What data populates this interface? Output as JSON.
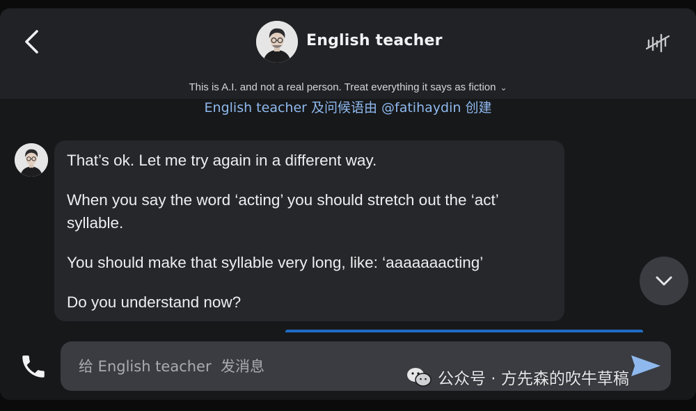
{
  "header": {
    "title": "English teacher",
    "disclaimer": "This is A.I. and not a real person. Treat everything it says as fiction",
    "back_icon": "chevron-left-icon",
    "voice_icon": "voice-waveform-icon"
  },
  "creator_line": "English teacher  及问候语由 @fatihaydin 创建",
  "message": {
    "paragraphs": [
      "That’s ok. Let me try again in a different way.",
      "When you say the word ‘acting’ you should stretch out the ‘act’ syllable.",
      "You should make that syllable very long, like: ‘aaaaaaacting’",
      "Do you understand now?"
    ]
  },
  "composer": {
    "placeholder": "给 English teacher  发消息",
    "value": ""
  },
  "watermark": "公众号 · 方先森的吹牛草稿",
  "colors": {
    "accent": "#1f6cc4",
    "link": "#8fb9ee",
    "send": "#8fb9ee"
  }
}
